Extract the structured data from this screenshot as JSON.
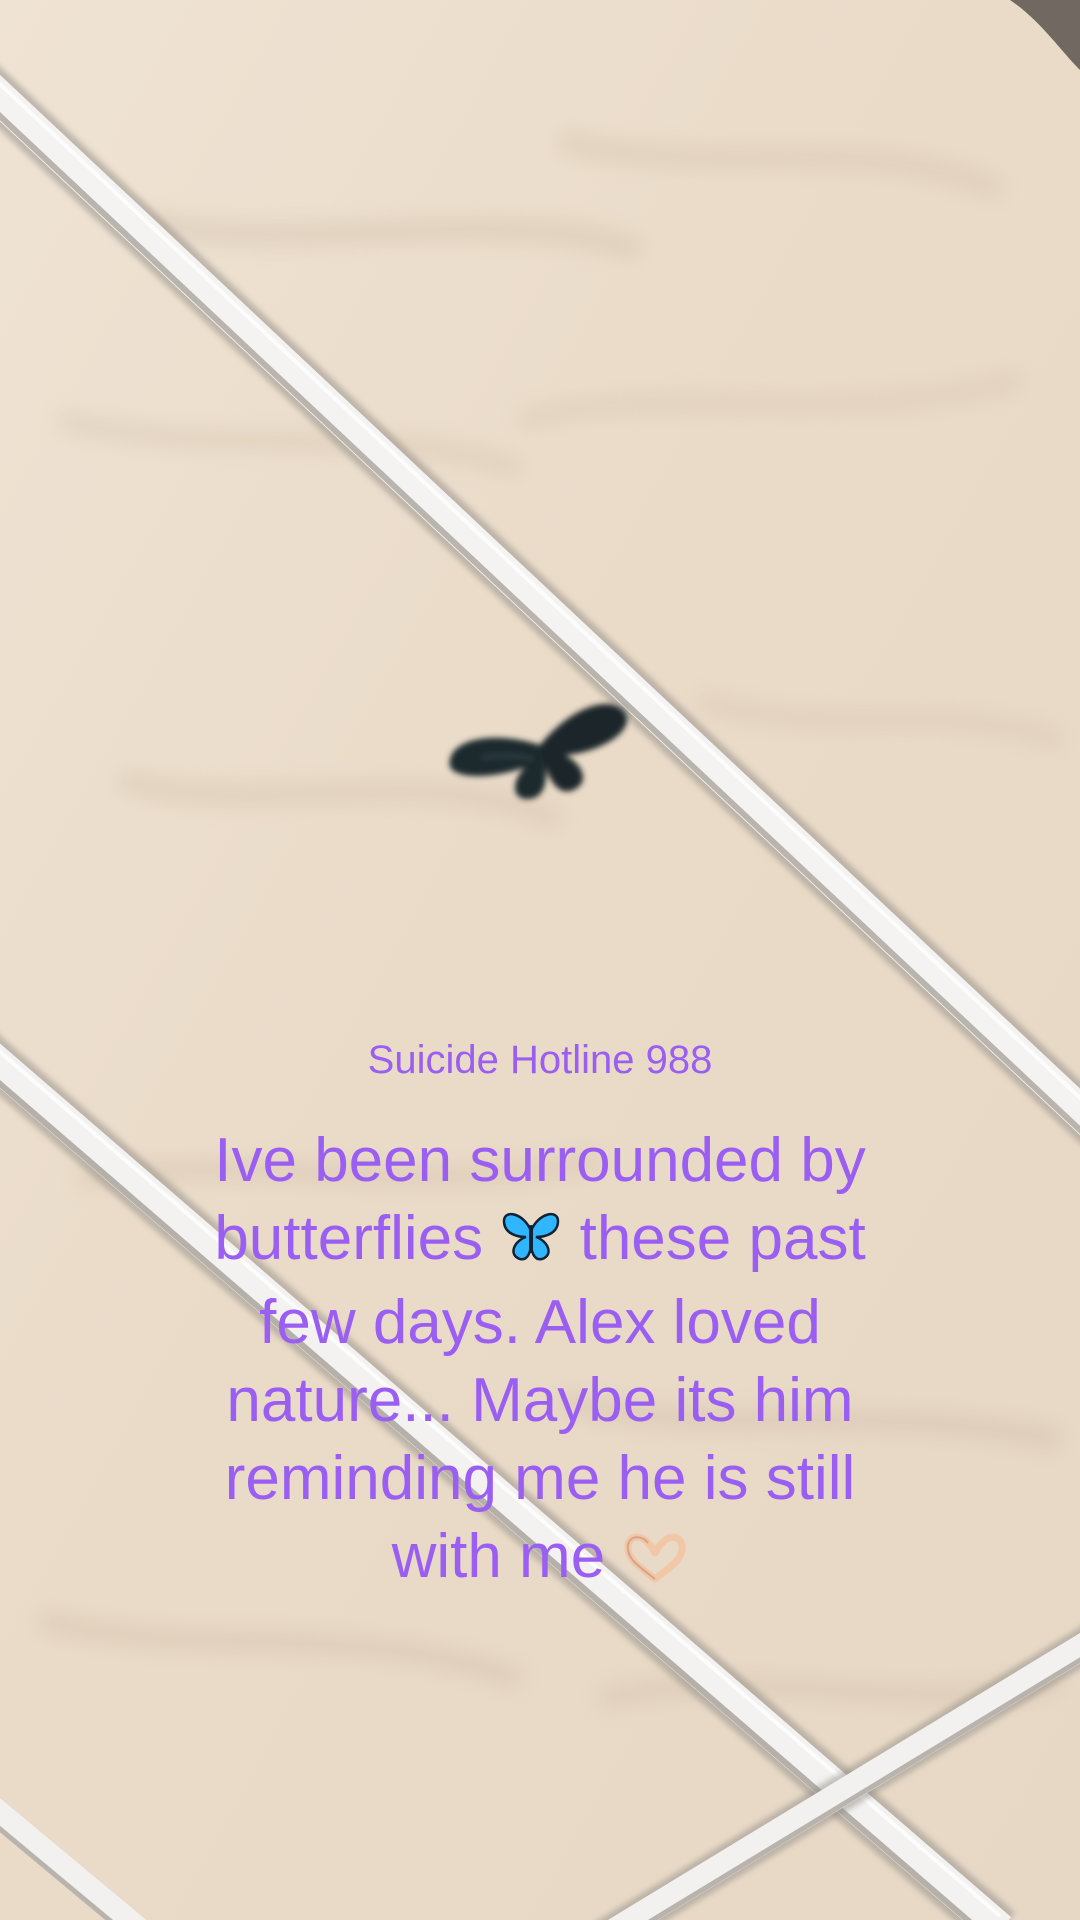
{
  "overlay": {
    "hotline_text": "Suicide Hotline 988",
    "caption_lines": [
      "Ive been surrounded by",
      "butterflies",
      "these past",
      "few days. Alex loved",
      "nature... Maybe its him",
      "reminding me he is still",
      "with me"
    ],
    "caption_icons": [
      "butterfly-emoji",
      "heart-hands-emoji"
    ],
    "text_color": "#9b5ef2"
  },
  "scene": {
    "subject": "butterfly-icon",
    "colors": {
      "ceiling": "#ecdfcf",
      "beam": "#f2f2f2",
      "butterfly": "#1e2a2e"
    }
  }
}
